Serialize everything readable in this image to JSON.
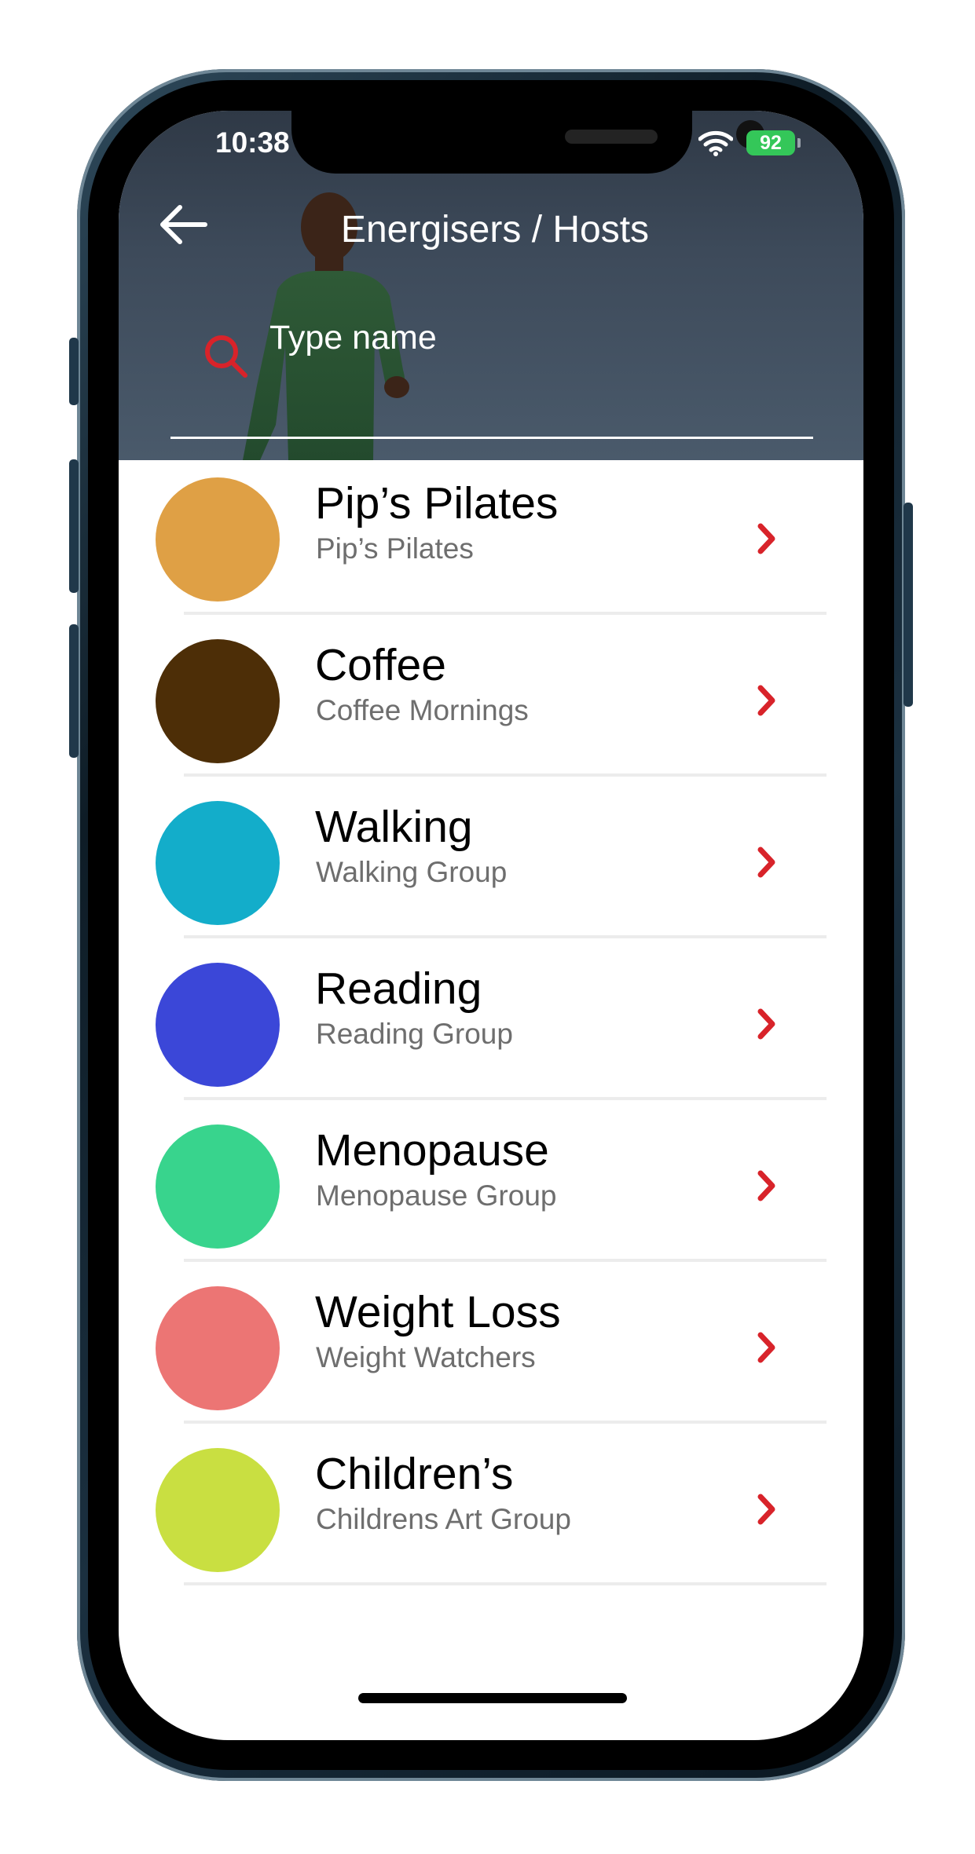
{
  "status_bar": {
    "time": "10:38",
    "battery": "92"
  },
  "header": {
    "title": "Energisers / Hosts"
  },
  "search": {
    "placeholder": "Type name"
  },
  "groups": [
    {
      "title": "Pip’s Pilates",
      "subtitle": "Pip’s Pilates",
      "color": "#dfa045"
    },
    {
      "title": "Coffee",
      "subtitle": "Coffee Mornings",
      "color": "#4d2e07"
    },
    {
      "title": "Walking",
      "subtitle": "Walking Group",
      "color": "#13adca"
    },
    {
      "title": "Reading",
      "subtitle": "Reading Group",
      "color": "#3b47d8"
    },
    {
      "title": "Menopause",
      "subtitle": "Menopause Group",
      "color": "#38d48d"
    },
    {
      "title": "Weight Loss",
      "subtitle": "Weight Watchers",
      "color": "#ec7574"
    },
    {
      "title": "Children’s",
      "subtitle": "Childrens Art Group",
      "color": "#c9df41"
    }
  ],
  "colors": {
    "accent": "#d8232a",
    "header_bg": "#3d4a5a"
  },
  "icons": {
    "back": "arrow-left-icon",
    "search": "search-icon",
    "row_action": "chevron-right-icon",
    "wifi": "wifi-icon"
  }
}
